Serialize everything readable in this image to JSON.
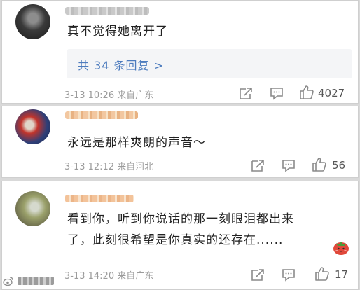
{
  "comments": [
    {
      "text": "真不觉得她离开了",
      "replies_link": "共 34 条回复 >",
      "time": "3-13 10:26",
      "location": "来自广东",
      "likes": "4027"
    },
    {
      "text": "永远是那样爽朗的声音～",
      "time": "3-13 12:12",
      "location": "来自河北",
      "likes": "56"
    },
    {
      "text": "看到你，听到你说话的那一刻眼泪都出来了，此刻很希望是你真实的还存在......",
      "time": "3-13 14:20",
      "location": "来自广东",
      "likes": "17"
    }
  ],
  "icons": {
    "share": "share-icon",
    "comment": "comment-icon",
    "like": "thumbs-up-icon",
    "sticker": "strawberry-sticker-icon",
    "watermark": "weibo-logo-icon"
  },
  "colors": {
    "link": "#4d7cbe",
    "meta": "#9b9b9b",
    "text": "#222222",
    "reply_bg": "#f4f5f7"
  }
}
